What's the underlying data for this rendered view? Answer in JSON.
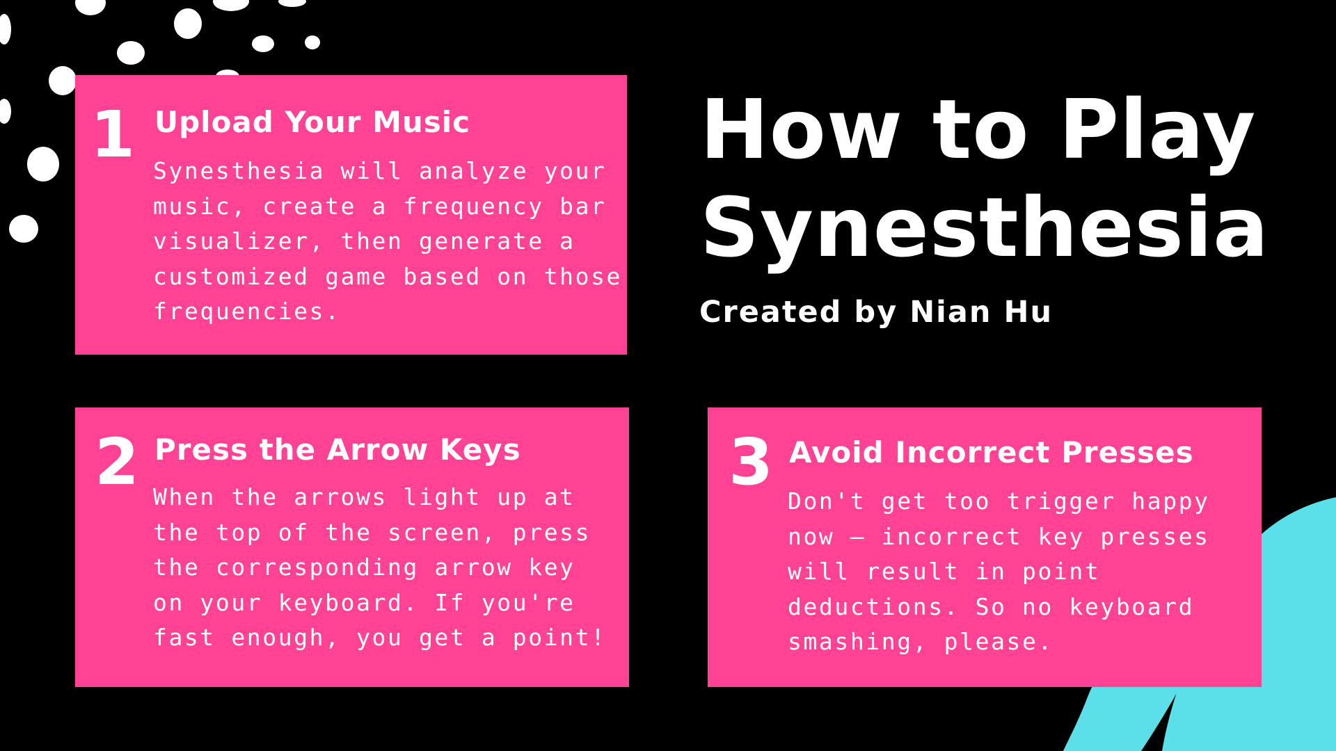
{
  "title": {
    "line1": "How to Play",
    "line2": "Synesthesia"
  },
  "byline": "Created by Nian Hu",
  "colors": {
    "background": "#000000",
    "card": "#ff4294",
    "text": "#ffffff",
    "accent_brush": "#5bdfe9",
    "dots": "#ffffff"
  },
  "steps": [
    {
      "number": "1",
      "title": "Upload Your Music",
      "body": "Synesthesia will analyze your\nmusic, create a frequency bar\nvisualizer, then generate a\ncustomized game based on those\nfrequencies."
    },
    {
      "number": "2",
      "title": "Press the Arrow Keys",
      "body": "When the arrows light up at\nthe top of the screen, press\nthe corresponding arrow key\non your keyboard. If you're\nfast enough, you get a point!"
    },
    {
      "number": "3",
      "title": "Avoid Incorrect Presses",
      "body": "Don't get too trigger happy\nnow – incorrect key presses\nwill result in point\ndeductions. So no keyboard\nsmashing, please."
    }
  ]
}
